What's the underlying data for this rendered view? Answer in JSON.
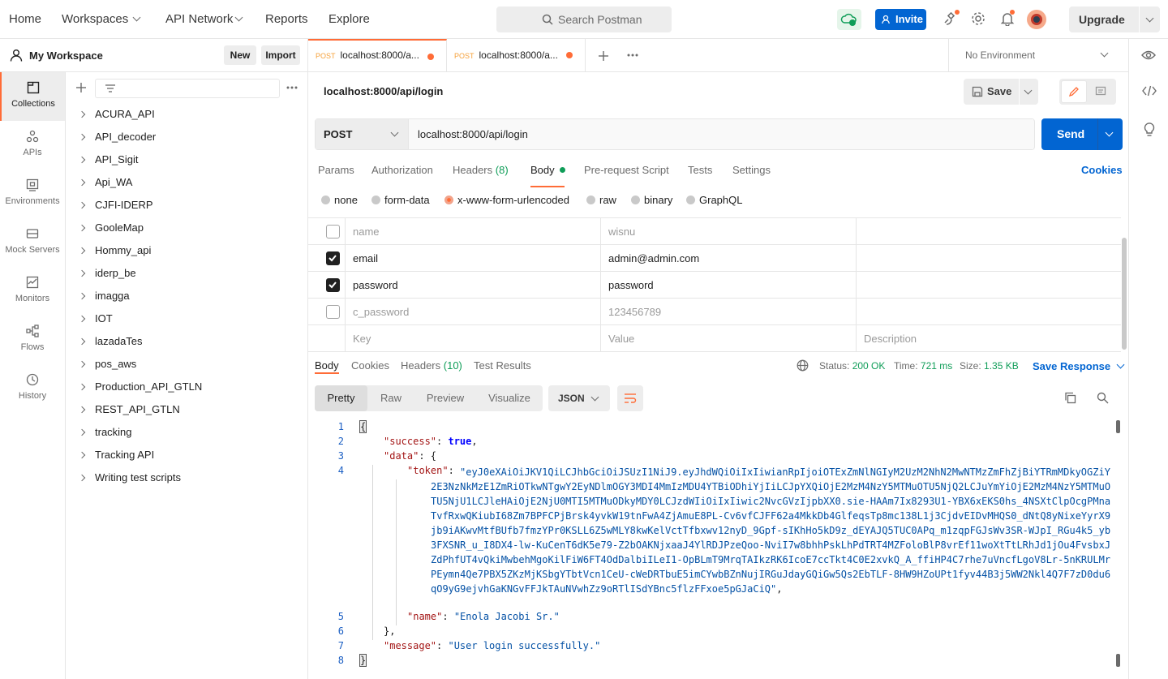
{
  "topbar": {
    "home": "Home",
    "workspaces": "Workspaces",
    "api_network": "API Network",
    "reports": "Reports",
    "explore": "Explore",
    "search_placeholder": "Search Postman",
    "invite": "Invite",
    "upgrade": "Upgrade"
  },
  "workspace": {
    "title": "My Workspace",
    "new_label": "New",
    "import_label": "Import"
  },
  "rail": [
    {
      "label": "Collections",
      "icon": "collections-icon"
    },
    {
      "label": "APIs",
      "icon": "apis-icon"
    },
    {
      "label": "Environments",
      "icon": "environments-icon"
    },
    {
      "label": "Mock Servers",
      "icon": "mock-servers-icon"
    },
    {
      "label": "Monitors",
      "icon": "monitors-icon"
    },
    {
      "label": "Flows",
      "icon": "flows-icon"
    },
    {
      "label": "History",
      "icon": "history-icon"
    }
  ],
  "collections": [
    "ACURA_API",
    "API_decoder",
    "API_Sigit",
    "Api_WA",
    "CJFI-IDERP",
    "GooleMap",
    "Hommy_api",
    "iderp_be",
    "imagga",
    "IOT",
    "lazadaTes",
    "pos_aws",
    "Production_API_GTLN",
    "REST_API_GTLN",
    "tracking",
    "Tracking API",
    "Writing test scripts"
  ],
  "tabs": [
    {
      "method": "POST",
      "title": "localhost:8000/a..."
    },
    {
      "method": "POST",
      "title": "localhost:8000/a..."
    }
  ],
  "environment": "No Environment",
  "request": {
    "title": "localhost:8000/api/login",
    "save": "Save",
    "method": "POST",
    "url": "localhost:8000/api/login",
    "send": "Send",
    "cookies": "Cookies"
  },
  "request_tabs": {
    "params": "Params",
    "authorization": "Authorization",
    "headers": "Headers",
    "headers_count": "(8)",
    "body": "Body",
    "prerequest": "Pre-request Script",
    "tests": "Tests",
    "settings": "Settings"
  },
  "body_types": {
    "none": "none",
    "form_data": "form-data",
    "urlencoded": "x-www-form-urlencoded",
    "raw": "raw",
    "binary": "binary",
    "graphql": "GraphQL",
    "selected": "x-www-form-urlencoded"
  },
  "params": [
    {
      "checked": false,
      "key": "name",
      "value": "wisnu"
    },
    {
      "checked": true,
      "key": "email",
      "value": "admin@admin.com"
    },
    {
      "checked": true,
      "key": "password",
      "value": "password"
    },
    {
      "checked": false,
      "key": "c_password",
      "value": "123456789"
    }
  ],
  "param_placeholders": {
    "key": "Key",
    "value": "Value",
    "description": "Description"
  },
  "response_tabs": {
    "body": "Body",
    "cookies": "Cookies",
    "headers": "Headers",
    "headers_count": "(10)",
    "test_results": "Test Results"
  },
  "response_stats": {
    "status_label": "Status:",
    "status": "200 OK",
    "time_label": "Time:",
    "time": "721 ms",
    "size_label": "Size:",
    "size": "1.35 KB",
    "save_response": "Save Response"
  },
  "view_modes": {
    "pretty": "Pretty",
    "raw": "Raw",
    "preview": "Preview",
    "visualize": "Visualize",
    "format": "JSON"
  },
  "response_body": {
    "line_numbers": [
      "1",
      "2",
      "3",
      "4",
      "5",
      "6",
      "7",
      "8"
    ],
    "open_brace": "{",
    "close_brace": "}",
    "success_key": "\"success\"",
    "success_val": "true",
    "data_key": "\"data\"",
    "token_key": "\"token\"",
    "token_value": "\"eyJ0eXAiOiJKV1QiLCJhbGciOiJSUzI1NiJ9.eyJhdWQiOiIxIiwianRpIjoiOTExZmNlNGIyM2UzM2NhN2MwNTMzZmFhZjBiYTRmMDkyOGZiY2E3NzNkMzE1ZmRiOTkwNTgwY2EyNDlmOGY3MDI4MmIzMDU4YTBiODhiYjIiLCJpYXQiOjE2MzM4NzY5MTMuOTU5NjQ2LCJuYmYiOjE2MzM4NzY5MTMuOTU5NjU1LCJleHAiOjE2NjU0MTI5MTMuODkyMDY0LCJzdWIiOiIxIiwic2NvcGVzIjpbXX0.sie-HAAm7Ix8293U1-YBX6xEKS0hs_4NSXtClpOcgPMnaTvfRxwQKiubI68Zm7BPFCPjBrsk4yvkW19tnFwA4ZjAmuE8PL-Cv6vfCJFF62a4MkkDb4GlfeqsTp8mc138L1j3CjdvEIDvMHQS0_dNtQ8yNixeYyrX9jb9iAKwvMtfBUfb7fmzYPr0KSLL6Z5wMLY8kwKelVctTfbxwv12nyD_9Gpf-sIKhHo5kD9z_dEYAJQ5TUC0APq_m1zqpFGJsWv3SR-WJpI_RGu4k5_yb3FXSNR_u_I8DX4-lw-KuCenT6dK5e79-Z2bOAKNjxaaJ4YlRDJPzeQoo-NviI7w8bhhPskLhPdTRT4MZFoloBlP8vrEf11woXtTtLRhJd1jOu4FvsbxJZdPhfUT4vQkiMwbehMgoKilFiW6FT4OdDalbiILeI1-OpBLmT9MrqTAIkzRK6IcoE7ccTkt4C0E2xvkQ_A_ffiHP4C7rhe7uVncfLgoV8Lr-5nKRULMrPEymn4Qe7PBX5ZKzMjKSbgYTbtVcn1CeU-cWeDRTbuE5imCYwbBZnNujIRGuJdayGQiGw5Qs2EbTLF-8HW9HZoUPt1fyv44B3j5WW2Nkl4Q7F7zD0du6qO9yG9ejvhGaKNGvFFJkTAuNVwhZz9oRTlISdYBnc5flzFFxoe5pGJaCiQ\"",
    "name_key": "\"name\"",
    "name_value": "\"Enola Jacobi Sr.\"",
    "message_key": "\"message\"",
    "message_value": "\"User login successfully.\""
  },
  "colors": {
    "accent": "#ff6c37",
    "primary": "#0265d2",
    "success": "#0f9d58"
  }
}
